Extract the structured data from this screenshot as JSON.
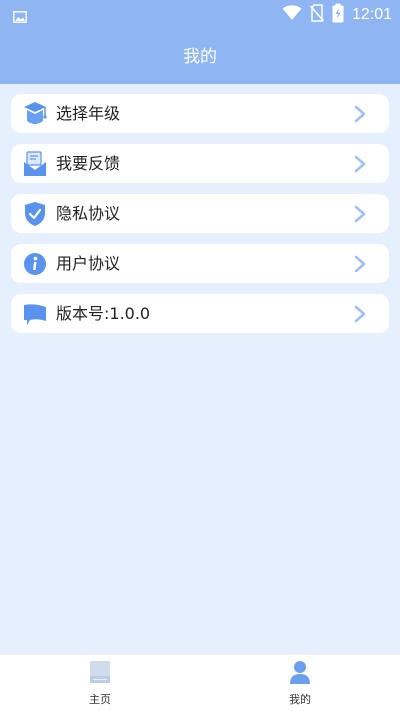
{
  "status_bar": {
    "time": "12:01",
    "icons": [
      "image-icon",
      "wifi-icon",
      "no-sim-icon",
      "battery-charging-icon"
    ]
  },
  "header": {
    "title": "我的"
  },
  "menu": {
    "items": [
      {
        "label": "选择年级",
        "icon": "graduation-cap-icon"
      },
      {
        "label": "我要反馈",
        "icon": "feedback-icon"
      },
      {
        "label": "隐私协议",
        "icon": "shield-check-icon"
      },
      {
        "label": "用户协议",
        "icon": "info-icon"
      },
      {
        "label": "版本号:1.0.0",
        "icon": "flag-icon"
      }
    ]
  },
  "bottom_nav": {
    "tabs": [
      {
        "label": "主页",
        "icon": "book-icon",
        "active": false
      },
      {
        "label": "我的",
        "icon": "person-icon",
        "active": true
      }
    ]
  },
  "colors": {
    "primary": "#8fb5f2",
    "background": "#e6effd",
    "icon_blue": "#5a93ee",
    "chevron": "#9fc0f4"
  }
}
